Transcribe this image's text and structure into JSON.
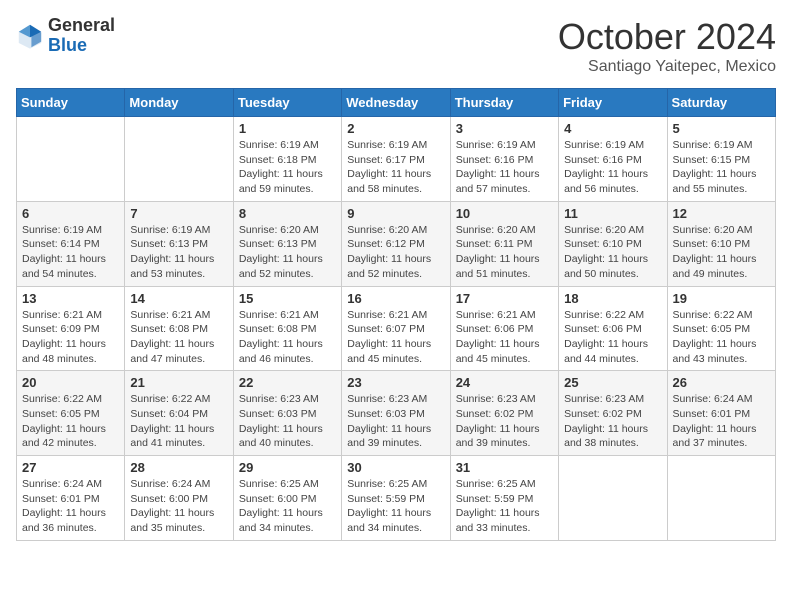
{
  "header": {
    "logo_general": "General",
    "logo_blue": "Blue",
    "month_title": "October 2024",
    "location": "Santiago Yaitepec, Mexico"
  },
  "weekdays": [
    "Sunday",
    "Monday",
    "Tuesday",
    "Wednesday",
    "Thursday",
    "Friday",
    "Saturday"
  ],
  "weeks": [
    [
      {
        "day": "",
        "info": ""
      },
      {
        "day": "",
        "info": ""
      },
      {
        "day": "1",
        "info": "Sunrise: 6:19 AM\nSunset: 6:18 PM\nDaylight: 11 hours and 59 minutes."
      },
      {
        "day": "2",
        "info": "Sunrise: 6:19 AM\nSunset: 6:17 PM\nDaylight: 11 hours and 58 minutes."
      },
      {
        "day": "3",
        "info": "Sunrise: 6:19 AM\nSunset: 6:16 PM\nDaylight: 11 hours and 57 minutes."
      },
      {
        "day": "4",
        "info": "Sunrise: 6:19 AM\nSunset: 6:16 PM\nDaylight: 11 hours and 56 minutes."
      },
      {
        "day": "5",
        "info": "Sunrise: 6:19 AM\nSunset: 6:15 PM\nDaylight: 11 hours and 55 minutes."
      }
    ],
    [
      {
        "day": "6",
        "info": "Sunrise: 6:19 AM\nSunset: 6:14 PM\nDaylight: 11 hours and 54 minutes."
      },
      {
        "day": "7",
        "info": "Sunrise: 6:19 AM\nSunset: 6:13 PM\nDaylight: 11 hours and 53 minutes."
      },
      {
        "day": "8",
        "info": "Sunrise: 6:20 AM\nSunset: 6:13 PM\nDaylight: 11 hours and 52 minutes."
      },
      {
        "day": "9",
        "info": "Sunrise: 6:20 AM\nSunset: 6:12 PM\nDaylight: 11 hours and 52 minutes."
      },
      {
        "day": "10",
        "info": "Sunrise: 6:20 AM\nSunset: 6:11 PM\nDaylight: 11 hours and 51 minutes."
      },
      {
        "day": "11",
        "info": "Sunrise: 6:20 AM\nSunset: 6:10 PM\nDaylight: 11 hours and 50 minutes."
      },
      {
        "day": "12",
        "info": "Sunrise: 6:20 AM\nSunset: 6:10 PM\nDaylight: 11 hours and 49 minutes."
      }
    ],
    [
      {
        "day": "13",
        "info": "Sunrise: 6:21 AM\nSunset: 6:09 PM\nDaylight: 11 hours and 48 minutes."
      },
      {
        "day": "14",
        "info": "Sunrise: 6:21 AM\nSunset: 6:08 PM\nDaylight: 11 hours and 47 minutes."
      },
      {
        "day": "15",
        "info": "Sunrise: 6:21 AM\nSunset: 6:08 PM\nDaylight: 11 hours and 46 minutes."
      },
      {
        "day": "16",
        "info": "Sunrise: 6:21 AM\nSunset: 6:07 PM\nDaylight: 11 hours and 45 minutes."
      },
      {
        "day": "17",
        "info": "Sunrise: 6:21 AM\nSunset: 6:06 PM\nDaylight: 11 hours and 45 minutes."
      },
      {
        "day": "18",
        "info": "Sunrise: 6:22 AM\nSunset: 6:06 PM\nDaylight: 11 hours and 44 minutes."
      },
      {
        "day": "19",
        "info": "Sunrise: 6:22 AM\nSunset: 6:05 PM\nDaylight: 11 hours and 43 minutes."
      }
    ],
    [
      {
        "day": "20",
        "info": "Sunrise: 6:22 AM\nSunset: 6:05 PM\nDaylight: 11 hours and 42 minutes."
      },
      {
        "day": "21",
        "info": "Sunrise: 6:22 AM\nSunset: 6:04 PM\nDaylight: 11 hours and 41 minutes."
      },
      {
        "day": "22",
        "info": "Sunrise: 6:23 AM\nSunset: 6:03 PM\nDaylight: 11 hours and 40 minutes."
      },
      {
        "day": "23",
        "info": "Sunrise: 6:23 AM\nSunset: 6:03 PM\nDaylight: 11 hours and 39 minutes."
      },
      {
        "day": "24",
        "info": "Sunrise: 6:23 AM\nSunset: 6:02 PM\nDaylight: 11 hours and 39 minutes."
      },
      {
        "day": "25",
        "info": "Sunrise: 6:23 AM\nSunset: 6:02 PM\nDaylight: 11 hours and 38 minutes."
      },
      {
        "day": "26",
        "info": "Sunrise: 6:24 AM\nSunset: 6:01 PM\nDaylight: 11 hours and 37 minutes."
      }
    ],
    [
      {
        "day": "27",
        "info": "Sunrise: 6:24 AM\nSunset: 6:01 PM\nDaylight: 11 hours and 36 minutes."
      },
      {
        "day": "28",
        "info": "Sunrise: 6:24 AM\nSunset: 6:00 PM\nDaylight: 11 hours and 35 minutes."
      },
      {
        "day": "29",
        "info": "Sunrise: 6:25 AM\nSunset: 6:00 PM\nDaylight: 11 hours and 34 minutes."
      },
      {
        "day": "30",
        "info": "Sunrise: 6:25 AM\nSunset: 5:59 PM\nDaylight: 11 hours and 34 minutes."
      },
      {
        "day": "31",
        "info": "Sunrise: 6:25 AM\nSunset: 5:59 PM\nDaylight: 11 hours and 33 minutes."
      },
      {
        "day": "",
        "info": ""
      },
      {
        "day": "",
        "info": ""
      }
    ]
  ]
}
